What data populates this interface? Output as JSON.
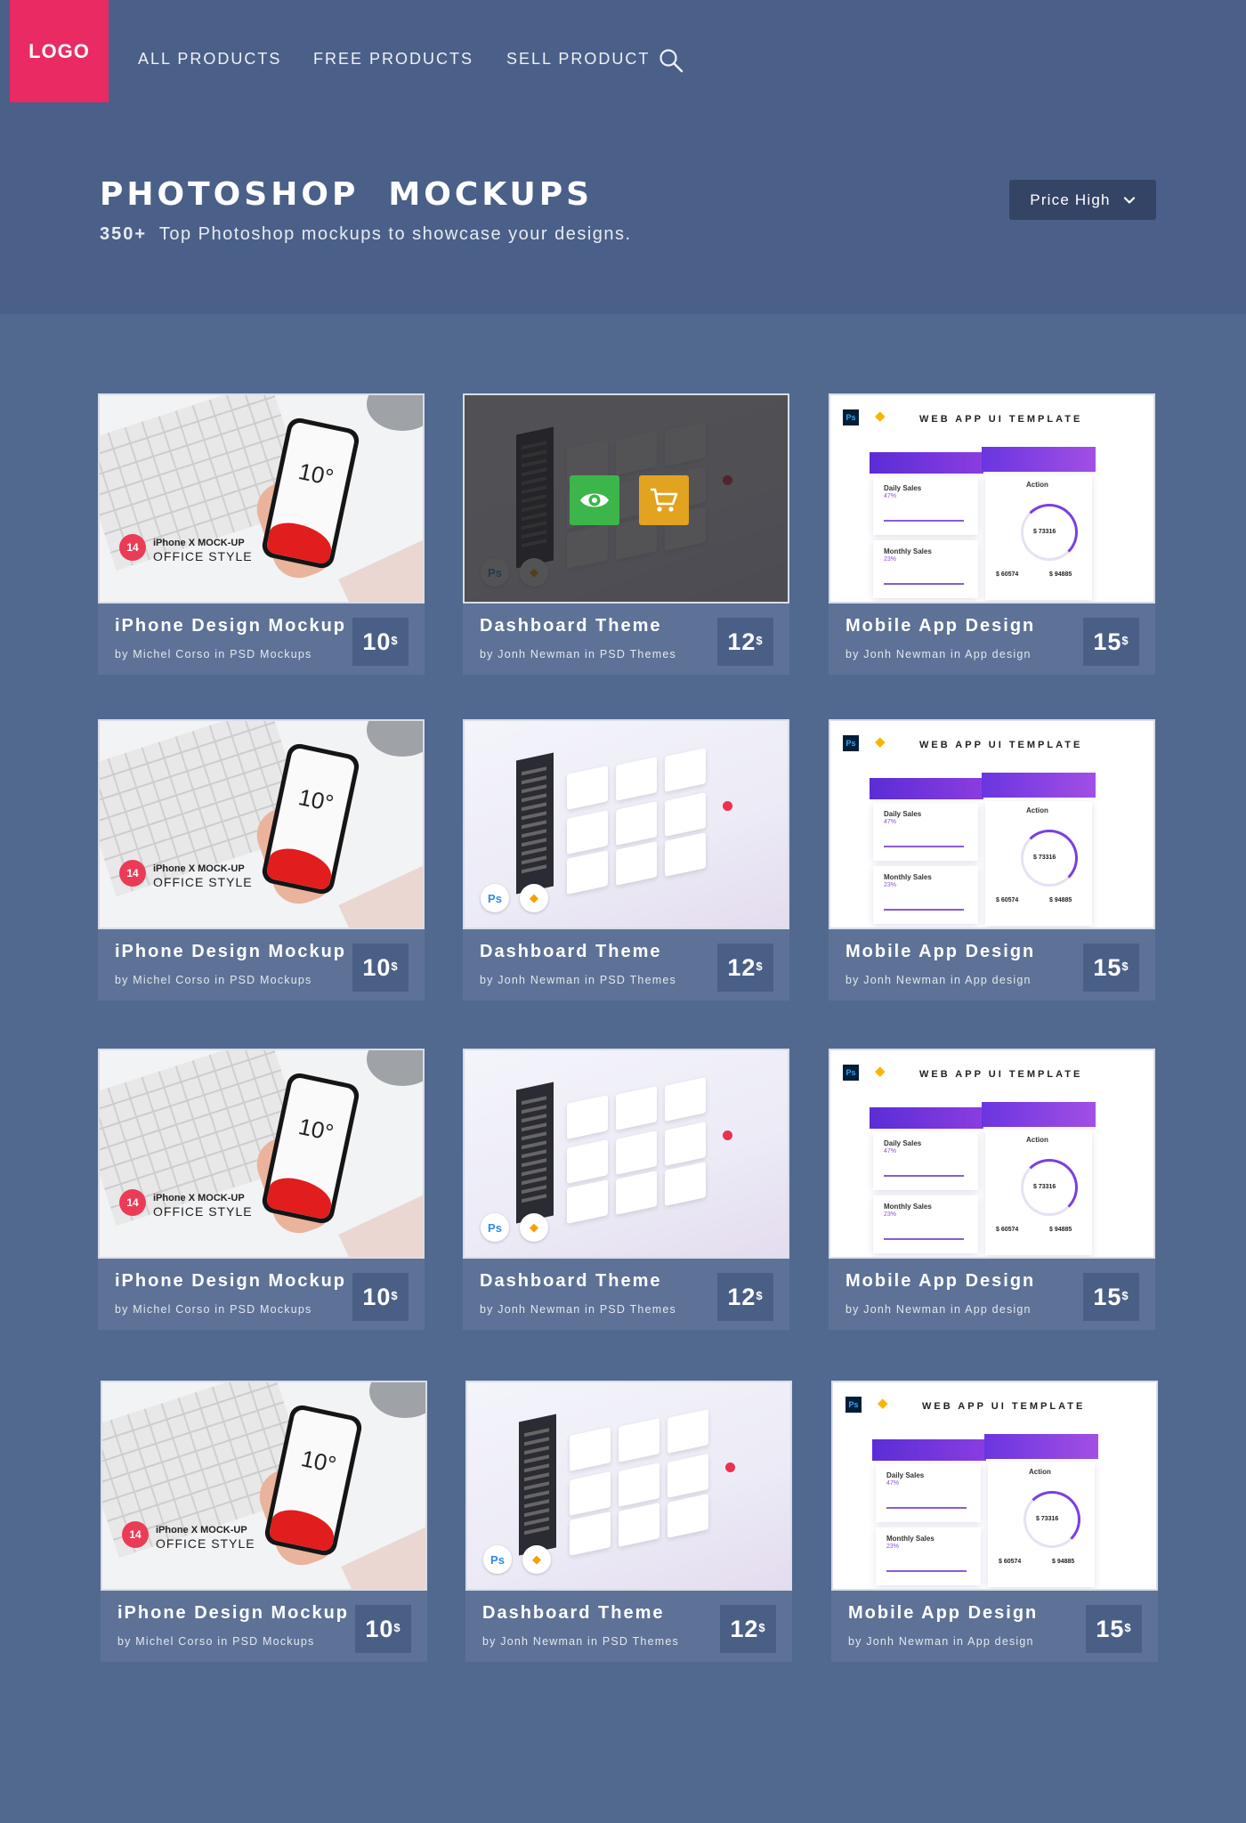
{
  "header": {
    "logo": "LOGO",
    "nav": [
      {
        "label": "ALL PRODUCTS"
      },
      {
        "label": "FREE  PRODUCTS"
      },
      {
        "label": "SELL PRODUCT"
      }
    ],
    "search_icon": "search-icon"
  },
  "hero": {
    "title": "PHOTOSHOP  MOCKUPS",
    "count": "350+",
    "subtitle": "  Top Photoshop mockups to showcase your designs."
  },
  "sort": {
    "selected": "Price High",
    "icon": "chevron-down-icon"
  },
  "colors": {
    "background": "#52698f",
    "hero": "#4a6089",
    "logo": "#ea2a63",
    "card_info": "#5d7296",
    "price_box": "#4a5f85",
    "view_button": "#3cb54a",
    "cart_button": "#e2a320"
  },
  "overlay": {
    "view_icon": "eye-icon",
    "cart_icon": "cart-icon"
  },
  "thumb_text": {
    "iphone_badge": "14",
    "iphone_line1": "iPhone X MOCK-UP",
    "iphone_line2": "OFFICE STYLE",
    "iphone_temp": "10°",
    "ps": "Ps",
    "webapp_title": "WEB APP UI TEMPLATE",
    "daily_sales": "Daily Sales",
    "daily_pct": "47%",
    "monthly_sales": "Monthly Sales",
    "monthly_pct": "23%",
    "action": "Action",
    "total": "$ 73316",
    "left_num": "$ 60574",
    "right_num": "$ 94885"
  },
  "products": [
    {
      "kind": "iphone",
      "title": "iPhone Design Mockup",
      "meta": "by Michel Corso in PSD Mockups",
      "price": "10",
      "currency": "$"
    },
    {
      "kind": "dashboard",
      "title": "Dashboard Theme",
      "meta": "by Jonh Newman in PSD Themes",
      "price": "12",
      "currency": "$",
      "hover": true
    },
    {
      "kind": "webapp",
      "title": "Mobile App Design",
      "meta": "by Jonh Newman in App design",
      "price": "15",
      "currency": "$"
    },
    {
      "kind": "iphone",
      "title": "iPhone Design Mockup",
      "meta": "by Michel Corso in PSD Mockups",
      "price": "10",
      "currency": "$"
    },
    {
      "kind": "dashboard",
      "title": "Dashboard Theme",
      "meta": "by Jonh Newman in PSD Themes",
      "price": "12",
      "currency": "$"
    },
    {
      "kind": "webapp",
      "title": "Mobile App Design",
      "meta": "by Jonh Newman in App design",
      "price": "15",
      "currency": "$"
    },
    {
      "kind": "iphone",
      "title": "iPhone Design Mockup",
      "meta": "by Michel Corso in PSD Mockups",
      "price": "10",
      "currency": "$"
    },
    {
      "kind": "dashboard",
      "title": "Dashboard Theme",
      "meta": "by Jonh Newman in PSD Themes",
      "price": "12",
      "currency": "$"
    },
    {
      "kind": "webapp",
      "title": "Mobile App Design",
      "meta": "by Jonh Newman in App design",
      "price": "15",
      "currency": "$"
    },
    {
      "kind": "iphone",
      "title": "iPhone Design Mockup",
      "meta": "by Michel Corso in PSD Mockups",
      "price": "10",
      "currency": "$"
    },
    {
      "kind": "dashboard",
      "title": "Dashboard Theme",
      "meta": "by Jonh Newman in PSD Themes",
      "price": "12",
      "currency": "$"
    },
    {
      "kind": "webapp",
      "title": "Mobile App Design",
      "meta": "by Jonh Newman in App design",
      "price": "15",
      "currency": "$"
    }
  ]
}
